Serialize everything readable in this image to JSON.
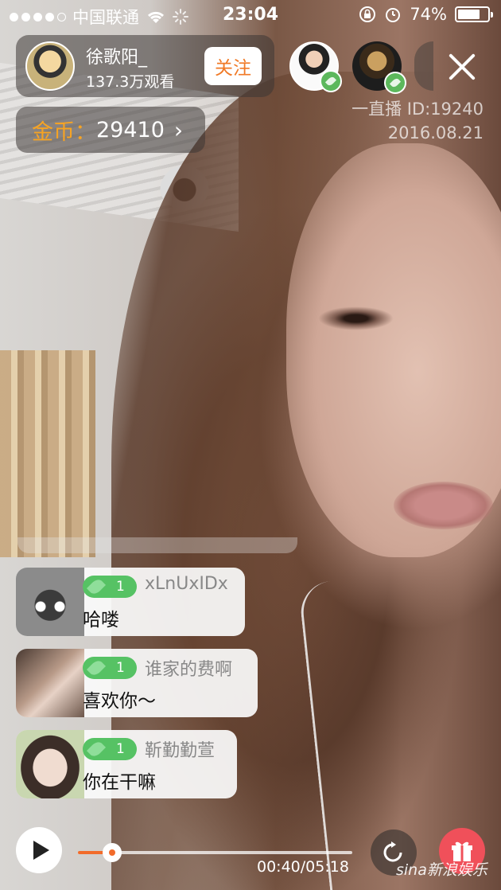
{
  "status_bar": {
    "carrier": "中国联通",
    "time": "23:04",
    "battery_text": "74%",
    "battery_level": 0.74
  },
  "host": {
    "name": "徐歌阳_",
    "viewers": "137.3万观看",
    "follow_label": "关注"
  },
  "coins": {
    "label": "金币：",
    "value": "29410",
    "chevron": "›"
  },
  "watermark": {
    "line1": "一直播 ID:19240",
    "line2": "2016.08.21"
  },
  "chat": [
    {
      "level": "1",
      "nick": "xLnUxIDx",
      "text": "哈喽"
    },
    {
      "level": "1",
      "nick": "谁家的费啊",
      "text": "喜欢你～"
    },
    {
      "level": "1",
      "nick": "靳勤勤萱",
      "text": "你在干嘛"
    }
  ],
  "playback": {
    "time": "00:40/05:18",
    "progress": 0.126
  },
  "credit": "sina新浪娱乐",
  "colors": {
    "accent_orange": "#f07a27",
    "coin_gold": "#f6a323",
    "level_green": "#56c264",
    "gift_red": "#f0505a"
  },
  "icons": [
    "wifi-icon",
    "loading-icon",
    "rotation-lock-icon",
    "alarm-icon",
    "battery-icon",
    "close-icon",
    "play-icon",
    "share-icon",
    "gift-icon",
    "leaf-icon"
  ]
}
